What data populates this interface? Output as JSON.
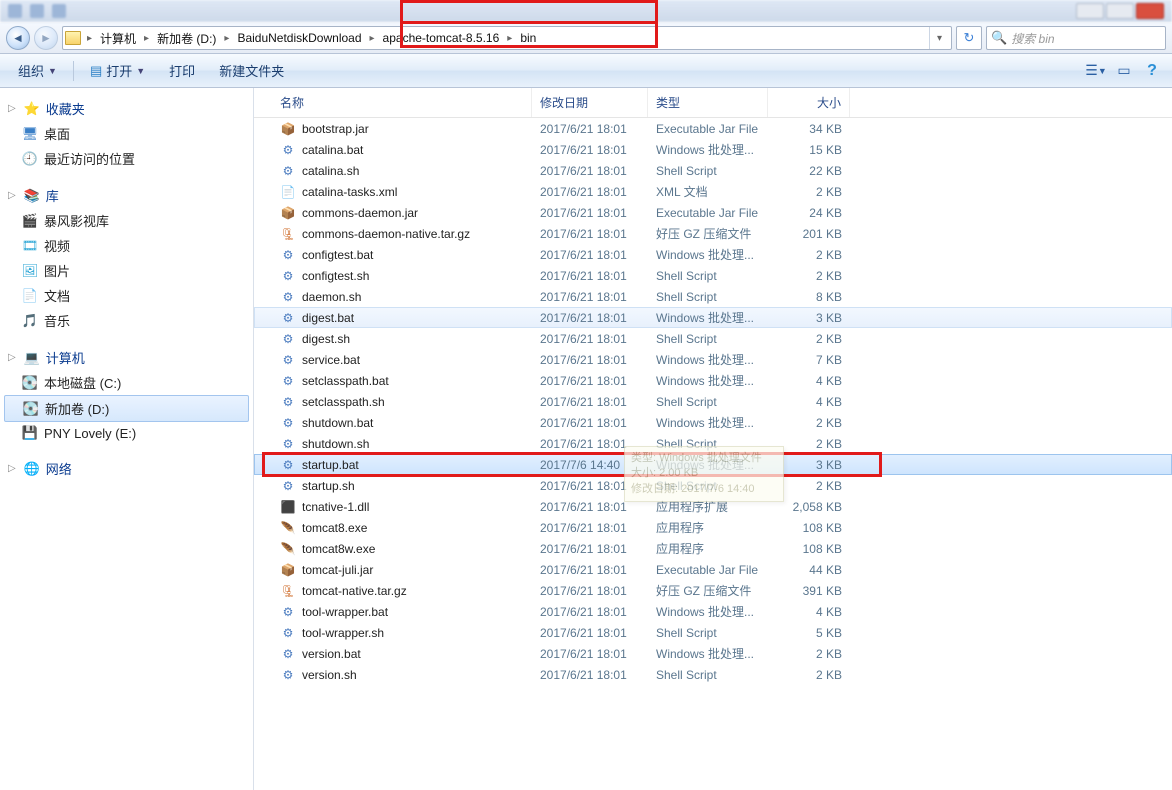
{
  "navbar": {
    "path": [
      "计算机",
      "新加卷 (D:)",
      "BaiduNetdiskDownload",
      "apache-tomcat-8.5.16",
      "bin"
    ],
    "search_placeholder": "搜索 bin"
  },
  "toolbar": {
    "org": "组织",
    "open": "打开",
    "print": "打印",
    "newfolder": "新建文件夹"
  },
  "sidebar": {
    "fav": "收藏夹",
    "desktop": "桌面",
    "recent": "最近访问的位置",
    "lib": "库",
    "bf": "暴风影视库",
    "video": "视频",
    "pic": "图片",
    "doc": "文档",
    "music": "音乐",
    "computer": "计算机",
    "c": "本地磁盘 (C:)",
    "d": "新加卷 (D:)",
    "e": "PNY Lovely (E:)",
    "net": "网络"
  },
  "columns": {
    "name": "名称",
    "date": "修改日期",
    "type": "类型",
    "size": "大小"
  },
  "files": [
    {
      "name": "bootstrap.jar",
      "date": "2017/6/21 18:01",
      "type": "Executable Jar File",
      "size": "34 KB",
      "ico": "jar"
    },
    {
      "name": "catalina.bat",
      "date": "2017/6/21 18:01",
      "type": "Windows 批处理...",
      "size": "15 KB",
      "ico": "bat"
    },
    {
      "name": "catalina.sh",
      "date": "2017/6/21 18:01",
      "type": "Shell Script",
      "size": "22 KB",
      "ico": "sh"
    },
    {
      "name": "catalina-tasks.xml",
      "date": "2017/6/21 18:01",
      "type": "XML 文档",
      "size": "2 KB",
      "ico": "xml"
    },
    {
      "name": "commons-daemon.jar",
      "date": "2017/6/21 18:01",
      "type": "Executable Jar File",
      "size": "24 KB",
      "ico": "jar"
    },
    {
      "name": "commons-daemon-native.tar.gz",
      "date": "2017/6/21 18:01",
      "type": "好压 GZ 压缩文件",
      "size": "201 KB",
      "ico": "gz"
    },
    {
      "name": "configtest.bat",
      "date": "2017/6/21 18:01",
      "type": "Windows 批处理...",
      "size": "2 KB",
      "ico": "bat"
    },
    {
      "name": "configtest.sh",
      "date": "2017/6/21 18:01",
      "type": "Shell Script",
      "size": "2 KB",
      "ico": "sh"
    },
    {
      "name": "daemon.sh",
      "date": "2017/6/21 18:01",
      "type": "Shell Script",
      "size": "8 KB",
      "ico": "sh"
    },
    {
      "name": "digest.bat",
      "date": "2017/6/21 18:01",
      "type": "Windows 批处理...",
      "size": "3 KB",
      "ico": "bat",
      "hover": true
    },
    {
      "name": "digest.sh",
      "date": "2017/6/21 18:01",
      "type": "Shell Script",
      "size": "2 KB",
      "ico": "sh"
    },
    {
      "name": "service.bat",
      "date": "2017/6/21 18:01",
      "type": "Windows 批处理...",
      "size": "7 KB",
      "ico": "bat"
    },
    {
      "name": "setclasspath.bat",
      "date": "2017/6/21 18:01",
      "type": "Windows 批处理...",
      "size": "4 KB",
      "ico": "bat"
    },
    {
      "name": "setclasspath.sh",
      "date": "2017/6/21 18:01",
      "type": "Shell Script",
      "size": "4 KB",
      "ico": "sh"
    },
    {
      "name": "shutdown.bat",
      "date": "2017/6/21 18:01",
      "type": "Windows 批处理...",
      "size": "2 KB",
      "ico": "bat"
    },
    {
      "name": "shutdown.sh",
      "date": "2017/6/21 18:01",
      "type": "Shell Script",
      "size": "2 KB",
      "ico": "sh"
    },
    {
      "name": "startup.bat",
      "date": "2017/7/6 14:40",
      "type": "Windows 批处理...",
      "size": "3 KB",
      "ico": "bat",
      "selected": true,
      "hl": true
    },
    {
      "name": "startup.sh",
      "date": "2017/6/21 18:01",
      "type": "Shell Script",
      "size": "2 KB",
      "ico": "sh"
    },
    {
      "name": "tcnative-1.dll",
      "date": "2017/6/21 18:01",
      "type": "应用程序扩展",
      "size": "2,058 KB",
      "ico": "dll"
    },
    {
      "name": "tomcat8.exe",
      "date": "2017/6/21 18:01",
      "type": "应用程序",
      "size": "108 KB",
      "ico": "exe"
    },
    {
      "name": "tomcat8w.exe",
      "date": "2017/6/21 18:01",
      "type": "应用程序",
      "size": "108 KB",
      "ico": "exe"
    },
    {
      "name": "tomcat-juli.jar",
      "date": "2017/6/21 18:01",
      "type": "Executable Jar File",
      "size": "44 KB",
      "ico": "jar"
    },
    {
      "name": "tomcat-native.tar.gz",
      "date": "2017/6/21 18:01",
      "type": "好压 GZ 压缩文件",
      "size": "391 KB",
      "ico": "gz"
    },
    {
      "name": "tool-wrapper.bat",
      "date": "2017/6/21 18:01",
      "type": "Windows 批处理...",
      "size": "4 KB",
      "ico": "bat"
    },
    {
      "name": "tool-wrapper.sh",
      "date": "2017/6/21 18:01",
      "type": "Shell Script",
      "size": "5 KB",
      "ico": "sh"
    },
    {
      "name": "version.bat",
      "date": "2017/6/21 18:01",
      "type": "Windows 批处理...",
      "size": "2 KB",
      "ico": "bat"
    },
    {
      "name": "version.sh",
      "date": "2017/6/21 18:01",
      "type": "Shell Script",
      "size": "2 KB",
      "ico": "sh"
    }
  ],
  "tooltip": {
    "l1": "类型: Windows 批处理文件",
    "l2": "大小: 2.00 KB",
    "l3": "修改日期: 2017/7/6 14:40"
  }
}
